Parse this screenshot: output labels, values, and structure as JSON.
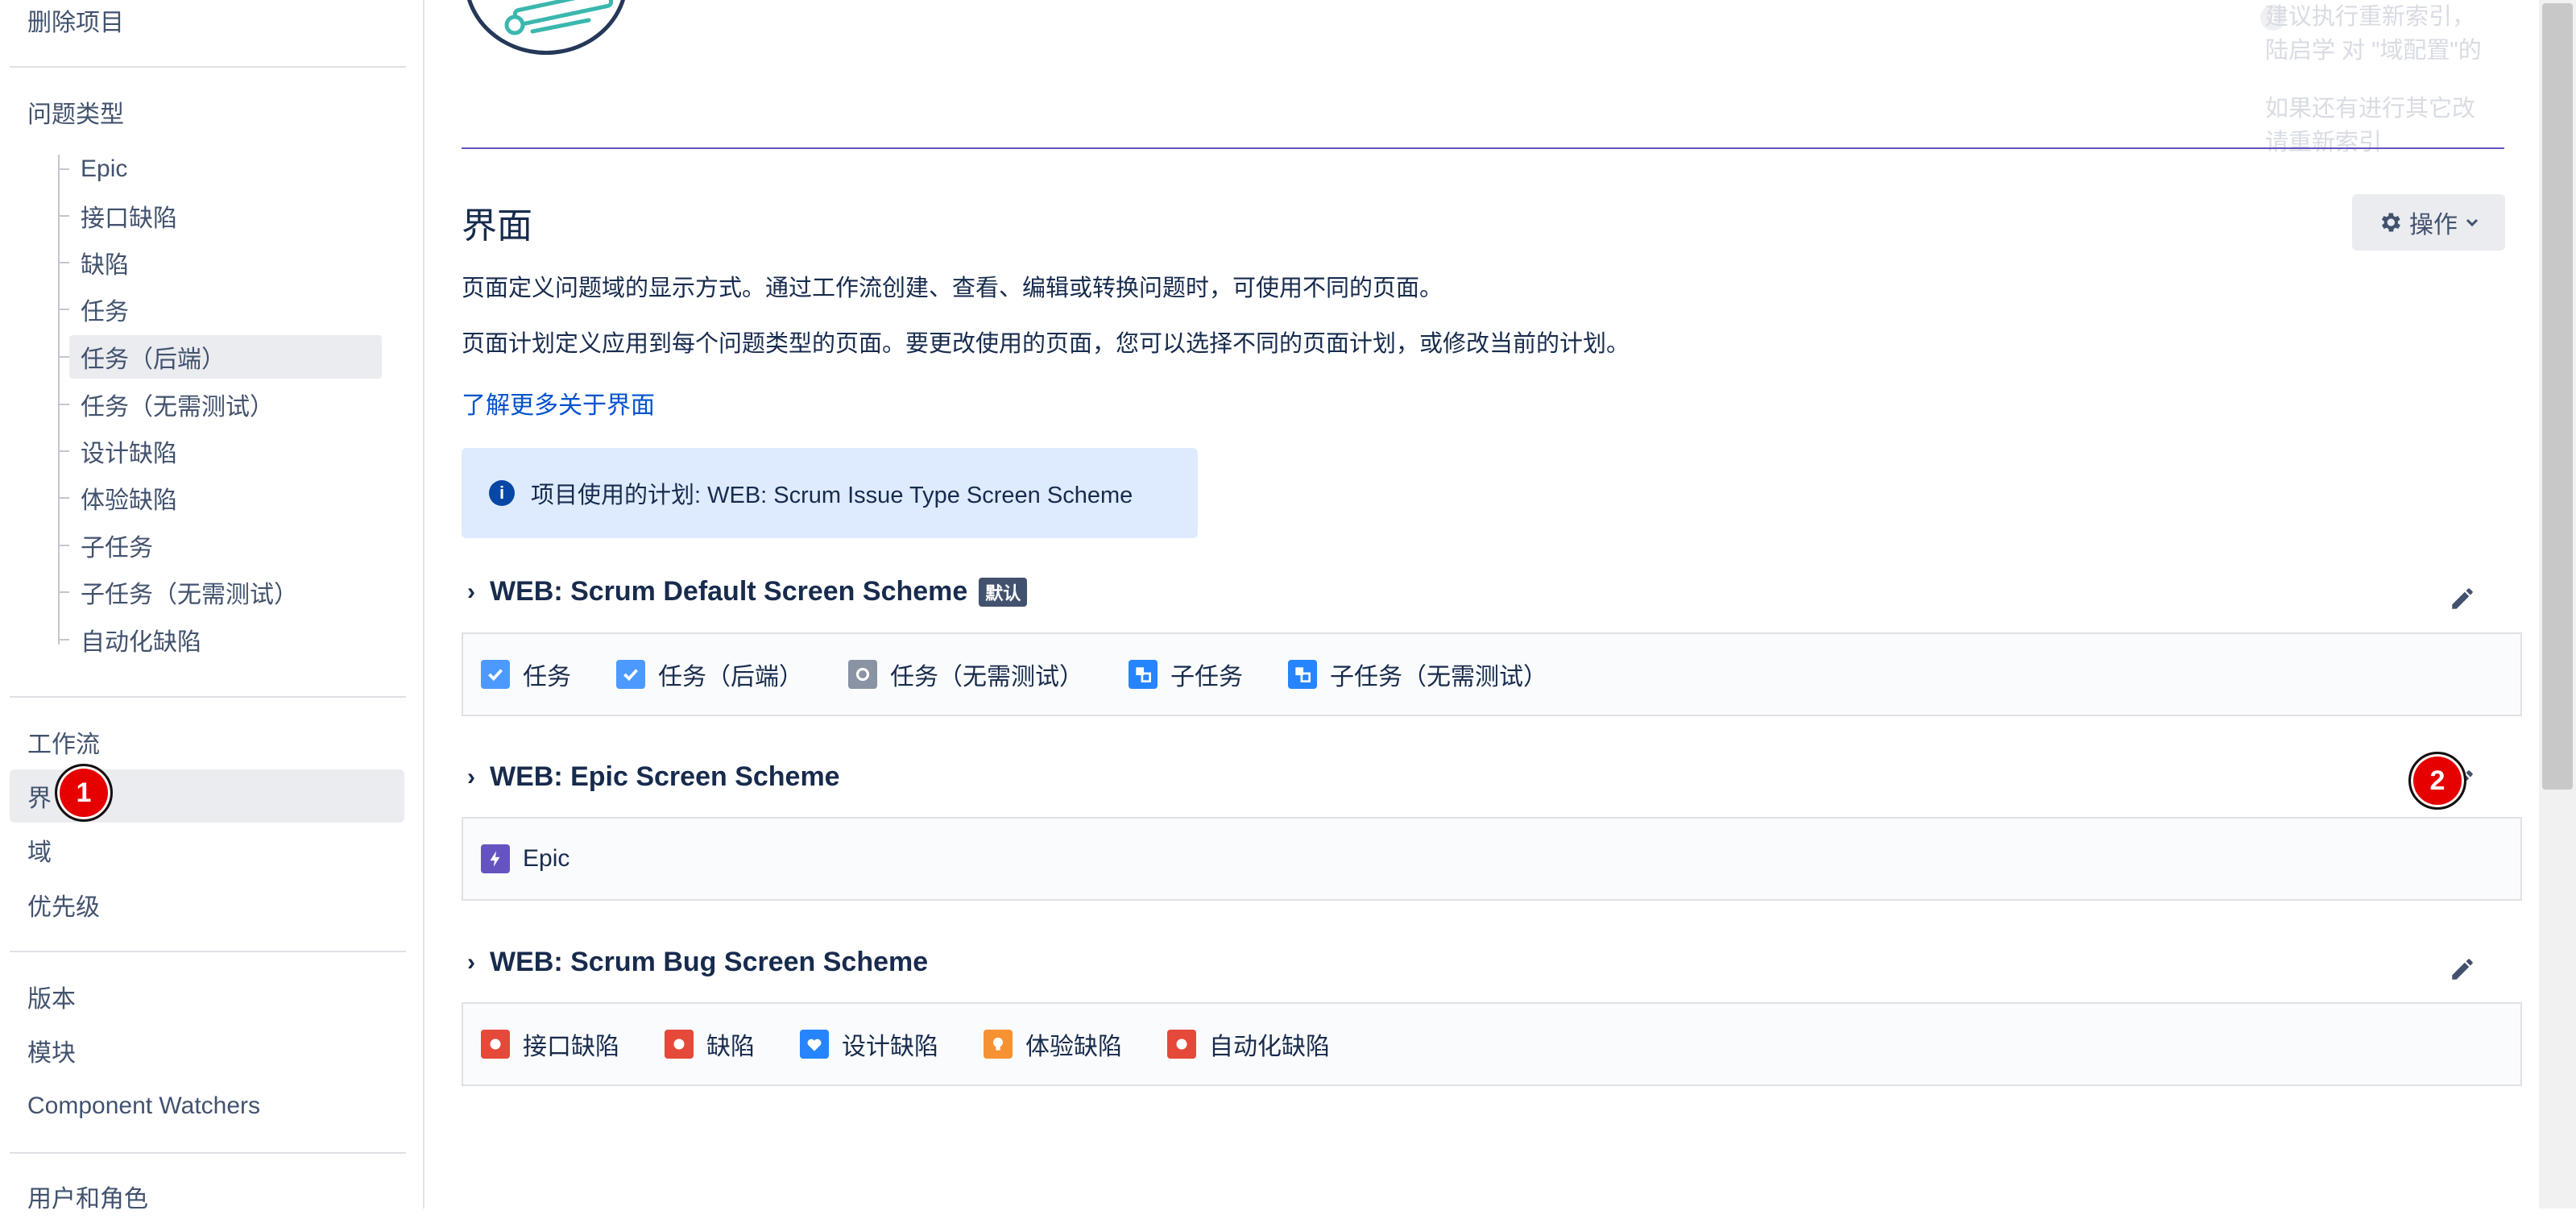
{
  "sidebar": {
    "delete_project": "删除项目",
    "issue_types_heading": "问题类型",
    "issue_types": [
      {
        "label": "Epic"
      },
      {
        "label": "接口缺陷"
      },
      {
        "label": "缺陷"
      },
      {
        "label": "任务"
      },
      {
        "label": "任务（后端）",
        "active": true
      },
      {
        "label": "任务（无需测试）"
      },
      {
        "label": "设计缺陷"
      },
      {
        "label": "体验缺陷"
      },
      {
        "label": "子任务"
      },
      {
        "label": "子任务（无需测试）"
      },
      {
        "label": "自动化缺陷"
      }
    ],
    "workflow": "工作流",
    "screens": "界",
    "fields": "域",
    "priorities": "优先级",
    "versions": "版本",
    "components": "模块",
    "component_watchers": "Component Watchers",
    "users_roles": "用户和角色"
  },
  "notice": {
    "line1": "建议执行重新索引，",
    "line2": "陆启学 对 \"域配置\"的",
    "line3": "如果还有进行其它改",
    "line4": "请重新索引"
  },
  "main": {
    "title": "界面",
    "operations_button": "操作",
    "desc1": "页面定义问题域的显示方式。通过工作流创建、查看、编辑或转换问题时，可使用不同的页面。",
    "desc2": "页面计划定义应用到每个问题类型的页面。要更改使用的页面，您可以选择不同的页面计划，或修改当前的计划。",
    "learn_more": "了解更多关于界面",
    "scheme_info": "项目使用的计划: WEB: Scrum Issue Type Screen Scheme"
  },
  "schemes": [
    {
      "name": "WEB: Scrum Default Screen Scheme",
      "badge": "默认",
      "issue_types": [
        "任务",
        "任务（后端）",
        "任务（无需测试）",
        "子任务",
        "子任务（无需测试）"
      ]
    },
    {
      "name": "WEB: Epic Screen Scheme",
      "issue_types": [
        "Epic"
      ]
    },
    {
      "name": "WEB: Scrum Bug Screen Scheme",
      "issue_types": [
        "接口缺陷",
        "缺陷",
        "设计缺陷",
        "体验缺陷",
        "自动化缺陷"
      ]
    }
  ],
  "markers": [
    "1",
    "2"
  ],
  "colors": {
    "accent": "#0052cc",
    "task_blue": "#4c9aff",
    "subtask_blue": "#2684ff",
    "epic_purple": "#6554c0",
    "bug_red": "#e5493a",
    "improvement_orange": "#f79232",
    "design_bug_blue": "#2684ff",
    "test_task_gray": "#8993a4",
    "marker_red": "#e60000"
  }
}
